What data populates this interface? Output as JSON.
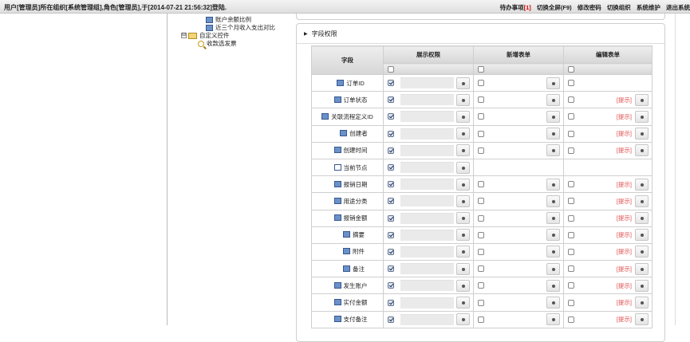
{
  "topbar": {
    "status": "用户[管理员]所在组织[系统管理组],角色[管理员],于[2014-07-21 21:56:32]登陆.",
    "todo_label": "待办事项",
    "todo_count": "[1]",
    "links": [
      "切换全屏(F9)",
      "修改密码",
      "切换组织",
      "系统维护",
      "退出系统"
    ]
  },
  "tree": {
    "items": [
      {
        "label": "账户余额比例",
        "icon": "document-icon"
      },
      {
        "label": "近三个月收入支出对比",
        "icon": "document-icon"
      },
      {
        "label": "自定义控件",
        "icon": "folder-icon",
        "toggle": "⊟"
      },
      {
        "label": "收款选发票",
        "icon": "magnifier-icon"
      }
    ]
  },
  "section": {
    "title": "字段权限"
  },
  "table": {
    "header": {
      "field": "字段",
      "show": "展示权限",
      "new": "新增表单",
      "edit": "编辑表单"
    },
    "header_select": {
      "show": false,
      "new": false,
      "edit": false
    },
    "tip_label": "[提示]",
    "rows": [
      {
        "name": "订单ID",
        "show": true,
        "new": false,
        "new_ctl": true,
        "edit": false,
        "edit_ctl": false,
        "tip": false,
        "indent": 1,
        "icon": "document-icon"
      },
      {
        "name": "订单状态",
        "show": true,
        "new": false,
        "new_ctl": true,
        "edit": false,
        "edit_ctl": true,
        "tip": true,
        "indent": 1,
        "icon": "document-icon"
      },
      {
        "name": "关联流程定义ID",
        "show": true,
        "new": false,
        "new_ctl": true,
        "edit": false,
        "edit_ctl": true,
        "tip": true,
        "indent": 0,
        "icon": "document-icon"
      },
      {
        "name": "创建者",
        "show": true,
        "new": false,
        "new_ctl": true,
        "edit": false,
        "edit_ctl": true,
        "tip": true,
        "indent": 2,
        "icon": "document-icon"
      },
      {
        "name": "创建时间",
        "show": true,
        "new": false,
        "new_ctl": true,
        "edit": false,
        "edit_ctl": true,
        "tip": true,
        "indent": 1,
        "icon": "document-icon"
      },
      {
        "name": "当前节点",
        "show": true,
        "new": false,
        "new_ctl": false,
        "edit": false,
        "edit_ctl": false,
        "tip": false,
        "indent": 1,
        "icon": "blank-document-icon"
      },
      {
        "name": "报销日期",
        "show": true,
        "new": false,
        "new_ctl": true,
        "edit": false,
        "edit_ctl": true,
        "tip": true,
        "indent": 1,
        "icon": "document-icon"
      },
      {
        "name": "用途分类",
        "show": true,
        "new": false,
        "new_ctl": true,
        "edit": false,
        "edit_ctl": true,
        "tip": true,
        "indent": 1,
        "icon": "document-icon"
      },
      {
        "name": "报销金额",
        "show": true,
        "new": false,
        "new_ctl": true,
        "edit": false,
        "edit_ctl": true,
        "tip": true,
        "indent": 1,
        "icon": "document-icon"
      },
      {
        "name": "摘要",
        "show": true,
        "new": false,
        "new_ctl": true,
        "edit": false,
        "edit_ctl": true,
        "tip": true,
        "indent": 2,
        "icon": "document-icon"
      },
      {
        "name": "附件",
        "show": true,
        "new": false,
        "new_ctl": true,
        "edit": false,
        "edit_ctl": true,
        "tip": true,
        "indent": 2,
        "icon": "document-icon"
      },
      {
        "name": "备注",
        "show": true,
        "new": false,
        "new_ctl": true,
        "edit": false,
        "edit_ctl": true,
        "tip": true,
        "indent": 2,
        "icon": "document-icon"
      },
      {
        "name": "发生账户",
        "show": true,
        "new": false,
        "new_ctl": true,
        "edit": false,
        "edit_ctl": true,
        "tip": true,
        "indent": 1,
        "icon": "document-icon"
      },
      {
        "name": "实付金额",
        "show": true,
        "new": false,
        "new_ctl": true,
        "edit": false,
        "edit_ctl": true,
        "tip": true,
        "indent": 1,
        "icon": "document-icon"
      },
      {
        "name": "支付备注",
        "show": true,
        "new": false,
        "new_ctl": true,
        "edit": false,
        "edit_ctl": true,
        "tip": true,
        "indent": 1,
        "icon": "document-icon"
      }
    ]
  }
}
